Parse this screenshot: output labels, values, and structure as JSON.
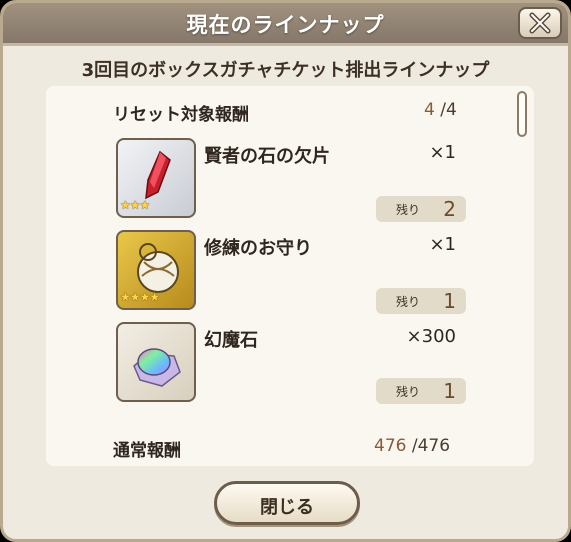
{
  "dialog": {
    "title": "現在のラインナップ",
    "subtitle": "3回目のボックスガチャチケット排出ラインナップ"
  },
  "reset_section": {
    "label": "リセット対象報酬",
    "current": "4",
    "total": "/4"
  },
  "items": [
    {
      "name": "賢者の石の欠片",
      "qty": "×1",
      "remain_label": "残り",
      "remain": "2",
      "stars": "★★★",
      "icon": "red-crystal-icon"
    },
    {
      "name": "修練のお守り",
      "qty": "×1",
      "remain_label": "残り",
      "remain": "1",
      "stars": "★★★★",
      "icon": "gold-amulet-icon"
    },
    {
      "name": "幻魔石",
      "qty": "×300",
      "remain_label": "残り",
      "remain": "1",
      "stars": "",
      "icon": "rainbow-stone-icon"
    }
  ],
  "normal_section": {
    "label": "通常報酬",
    "current": "476",
    "total": "/476"
  },
  "buttons": {
    "close": "閉じる"
  }
}
